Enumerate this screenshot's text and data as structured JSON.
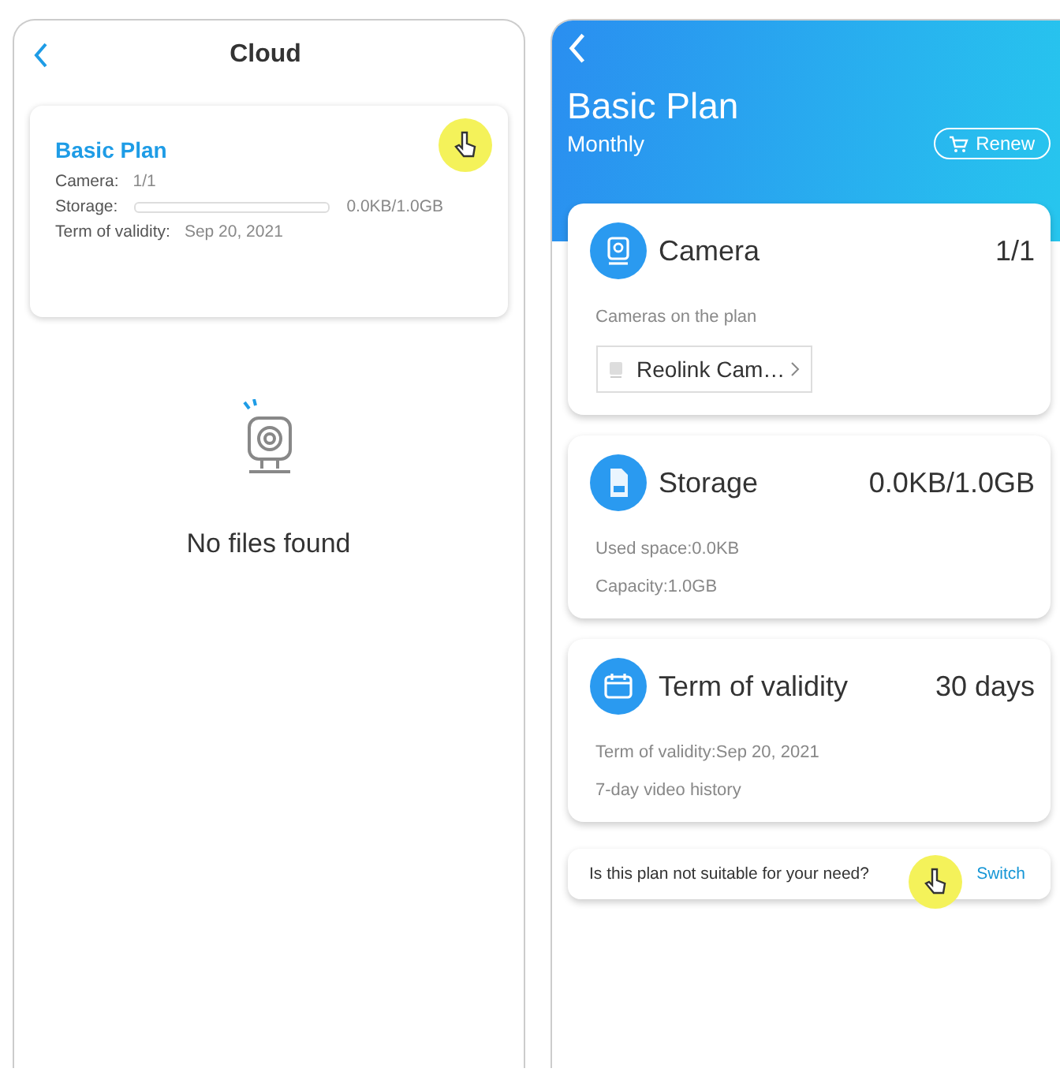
{
  "left_screen": {
    "title": "Cloud",
    "plan_card": {
      "title": "Basic Plan",
      "camera_label": "Camera:",
      "camera_value": "1/1",
      "storage": {
        "label": "Storage:",
        "level": 0,
        "value": "0.0KB/1.0GB"
      },
      "validity_label": "Term of validity:",
      "validity_value": "Sep 20, 2021"
    },
    "empty_state": {
      "message": "No files found"
    }
  },
  "right_screen": {
    "title": "Basic Plan",
    "subtitle": "Monthly",
    "renew_button": "Renew",
    "cards": [
      {
        "kind": "camera",
        "title": "Camera",
        "value": "1/1",
        "lines": [
          "Cameras on the plan"
        ],
        "device": "Reolink Cam…"
      },
      {
        "kind": "storage",
        "title": "Storage",
        "value": "0.0KB/1.0GB",
        "lines": [
          "Used space:0.0KB",
          "Capacity:1.0GB"
        ]
      },
      {
        "kind": "validity",
        "title": "Term of validity",
        "value": "30 days",
        "lines": [
          "Term of validity:Sep 20, 2021",
          "7-day video history"
        ]
      }
    ],
    "switch_bar": {
      "question": "Is this plan not suitable for your need?",
      "link": "Switch"
    }
  }
}
